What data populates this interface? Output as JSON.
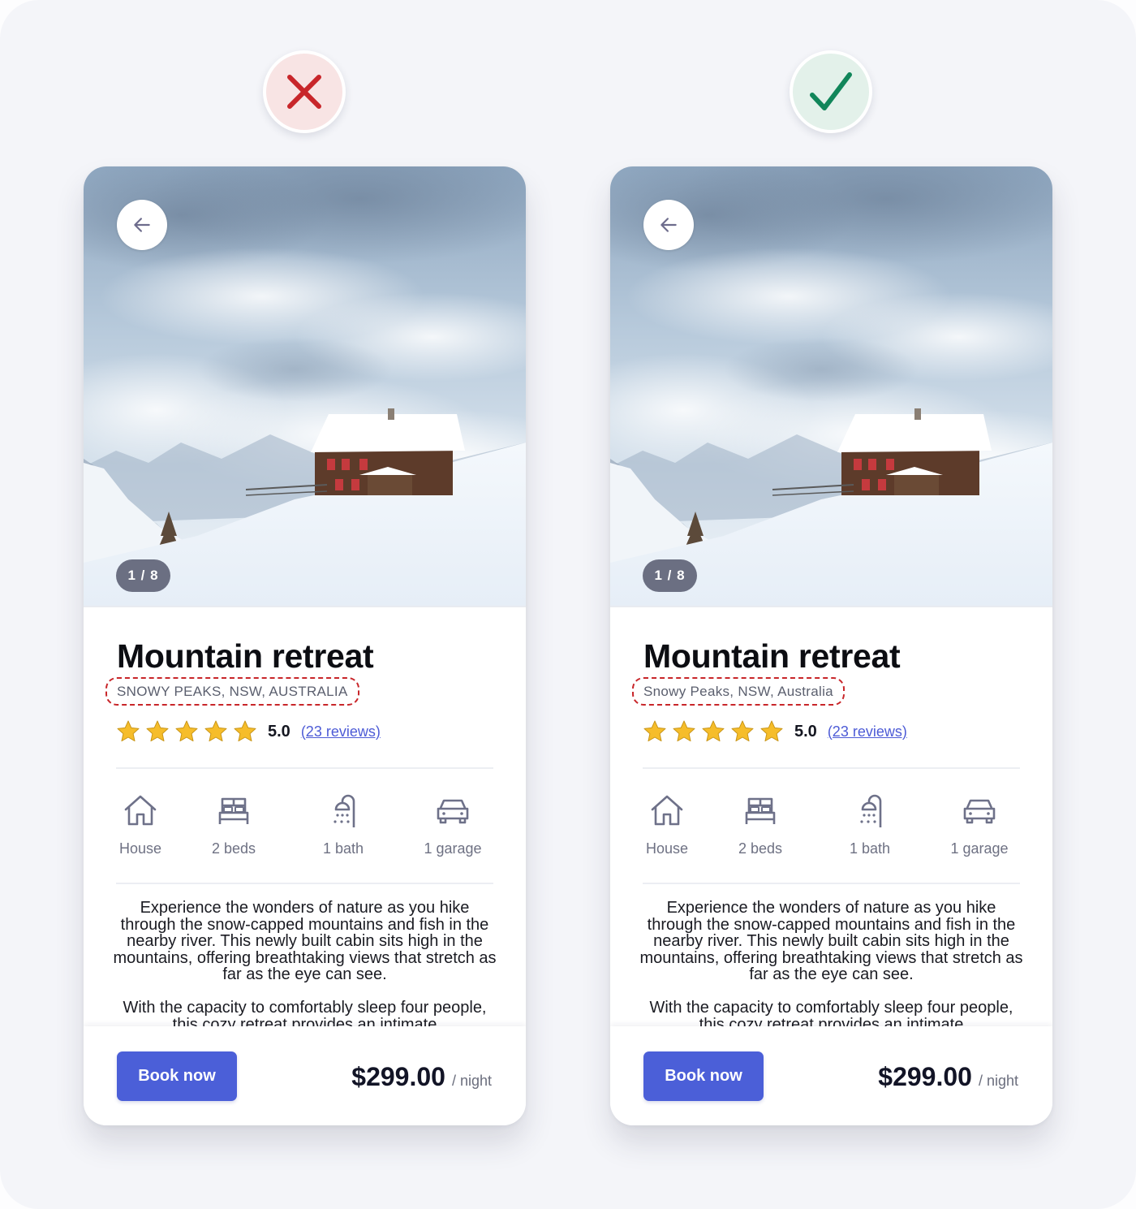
{
  "verdicts": {
    "bad": {
      "icon": "cross-icon",
      "color": "#c8262a",
      "bg": "#f8e4e4"
    },
    "good": {
      "icon": "check-icon",
      "color": "#11865a",
      "bg": "#e3f1ea"
    }
  },
  "cards": [
    {
      "variant": "incorrect",
      "image_counter": "1 / 8",
      "title": "Mountain retreat",
      "location": "SNOWY PEAKS, NSW, AUSTRALIA",
      "rating": {
        "stars": 5,
        "max": 5,
        "value": "5.0",
        "reviews_label": "(23 reviews)"
      },
      "features": [
        {
          "icon": "house-icon",
          "label": "House"
        },
        {
          "icon": "bed-icon",
          "label": "2 beds"
        },
        {
          "icon": "shower-icon",
          "label": "1 bath"
        },
        {
          "icon": "car-icon",
          "label": "1 garage"
        }
      ],
      "description": [
        "Experience the wonders of nature as you hike through the snow-capped mountains and fish in the nearby river. This newly built cabin sits high in the mountains, offering breathtaking views that stretch as far as the eye can see.",
        "With the capacity to comfortably sleep four people, this cozy retreat provides an intimate"
      ],
      "book_label": "Book now",
      "price": "$299.00",
      "price_unit": "/ night"
    },
    {
      "variant": "correct",
      "image_counter": "1 / 8",
      "title": "Mountain retreat",
      "location": "Snowy Peaks, NSW, Australia",
      "rating": {
        "stars": 5,
        "max": 5,
        "value": "5.0",
        "reviews_label": "(23 reviews)"
      },
      "features": [
        {
          "icon": "house-icon",
          "label": "House"
        },
        {
          "icon": "bed-icon",
          "label": "2 beds"
        },
        {
          "icon": "shower-icon",
          "label": "1 bath"
        },
        {
          "icon": "car-icon",
          "label": "1 garage"
        }
      ],
      "description": [
        "Experience the wonders of nature as you hike through the snow-capped mountains and fish in the nearby river. This newly built cabin sits high in the mountains, offering breathtaking views that stretch as far as the eye can see.",
        "With the capacity to comfortably sleep four people, this cozy retreat provides an intimate"
      ],
      "book_label": "Book now",
      "price": "$299.00",
      "price_unit": "/ night"
    }
  ],
  "colors": {
    "accent": "#4b5fd8",
    "highlight_dash": "#c8262a",
    "star": "#f6bd2a",
    "icon": "#6e7189"
  }
}
